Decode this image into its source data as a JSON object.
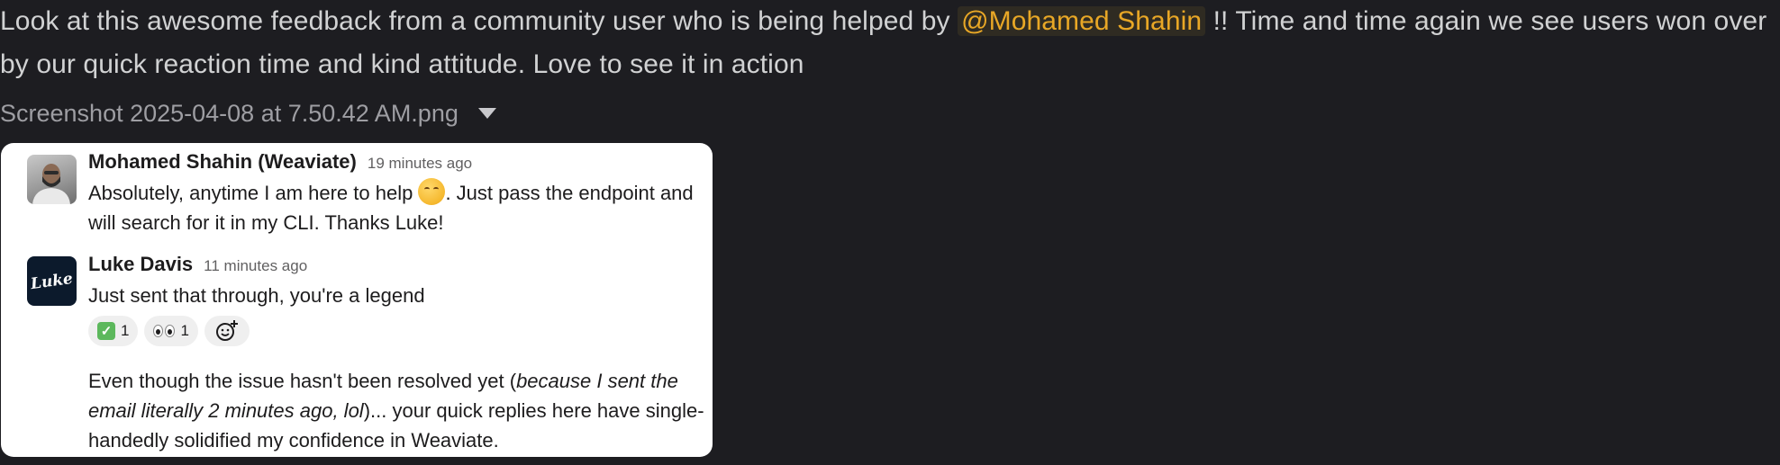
{
  "post": {
    "text_before": "Look at this awesome feedback from a community user who is being helped by ",
    "mention": "@Mohamed Shahin",
    "text_after": " !! Time and time again we see users won over by our quick reaction time and kind attitude. Love to see it in action"
  },
  "attachment": {
    "filename": "Screenshot 2025-04-08 at 7.50.42 AM.png"
  },
  "screenshot": {
    "messages": [
      {
        "author": "Mohamed Shahin (Weaviate)",
        "time": "19 minutes ago",
        "line1_before": "Absolutely, anytime I am here to help ",
        "line1_after": ". Just pass the endpoint and",
        "line2": "will search for it in my CLI. Thanks Luke!"
      },
      {
        "author": "Luke Davis",
        "time": "11 minutes ago",
        "avatar_text": "Luke",
        "text": "Just sent that through, you're a legend",
        "reactions": [
          {
            "icon": "white-check-mark-icon",
            "count": "1"
          },
          {
            "icon": "eyes-icon",
            "count": "1"
          }
        ],
        "followup": {
          "part1": "Even though the issue hasn't been resolved yet (",
          "italic": "because I sent the email literally 2 minutes ago, lol",
          "part2": ")... your quick replies here have single-handedly solidified my confidence in Weaviate."
        }
      }
    ]
  }
}
